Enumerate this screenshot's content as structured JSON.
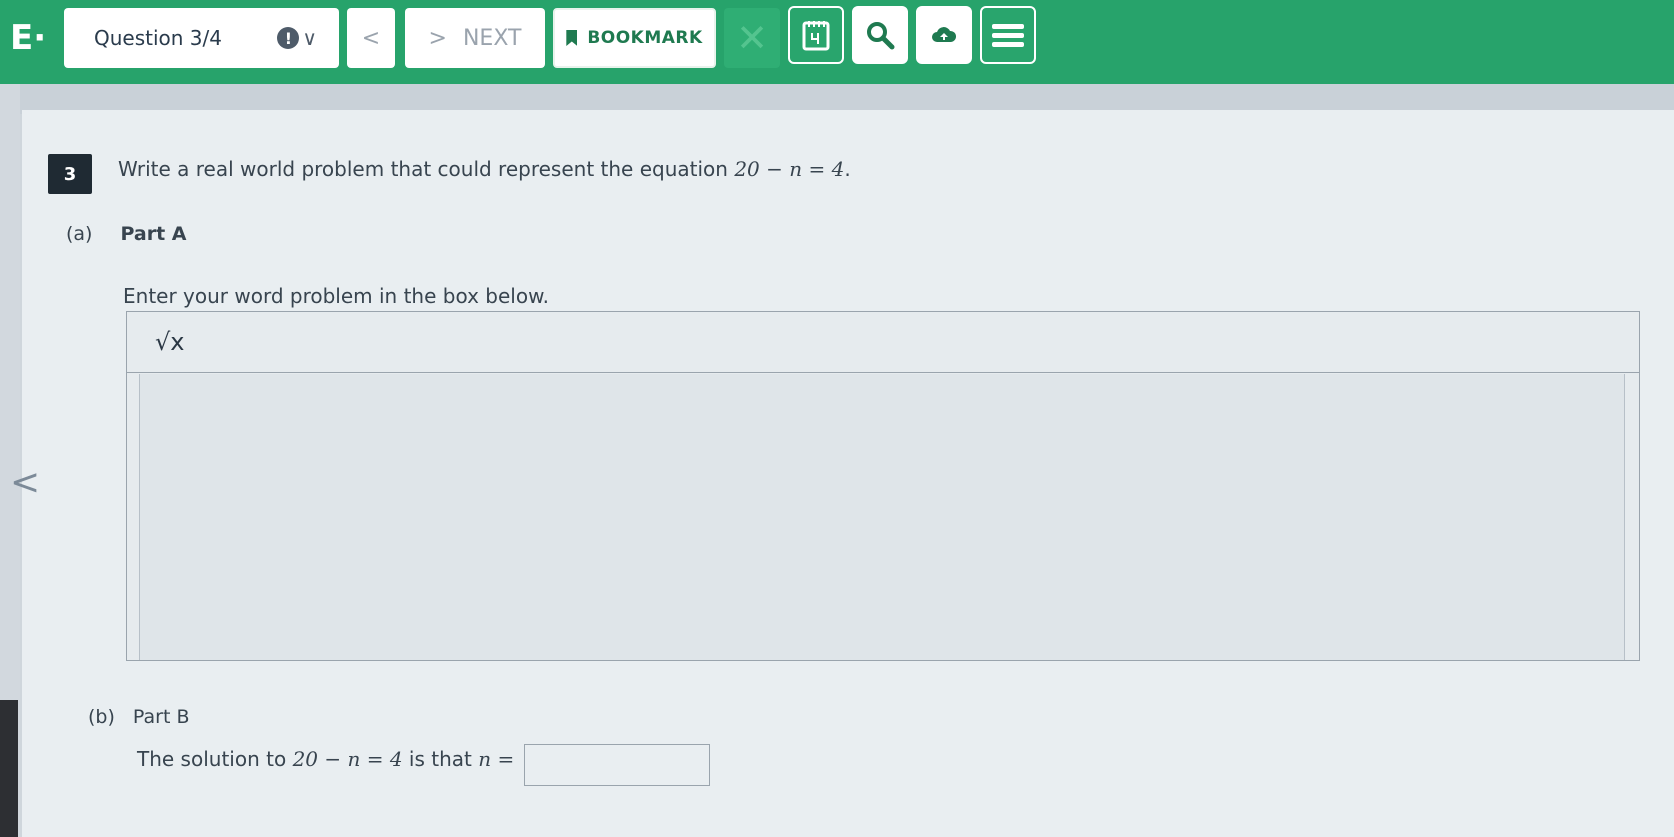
{
  "header": {
    "logo": "E·",
    "question_select": "Question 3/4",
    "flag_badge": "!",
    "flag_chevron": "∨",
    "prev_label": "<",
    "next_arrow": ">",
    "next_label": "NEXT",
    "bookmark_label": "BOOKMARK",
    "close_label": "✕"
  },
  "tools": [
    "calculator-icon",
    "magnify-icon",
    "cloud-icon",
    "menu-icon"
  ],
  "question": {
    "number": "3",
    "text": "Write a real world problem that could represent the equation",
    "equation": "20 − n = 4",
    "end": "."
  },
  "part_a": {
    "letter": "(a)",
    "title": "Part A",
    "instruction": "Enter your word problem in the box below.",
    "sqrt_tool": "√x"
  },
  "part_b": {
    "letter": "(b)",
    "title": "Part B",
    "solution_prefix": "The solution to",
    "equation": "20 − n = 4",
    "solution_mid": "is that",
    "var": "n =",
    "answer_value": ""
  },
  "nav": {
    "left_arrow": "<"
  },
  "colors": {
    "header": "#27a36b",
    "bookmark": "#1f7a50",
    "card": "#e9eef1"
  }
}
